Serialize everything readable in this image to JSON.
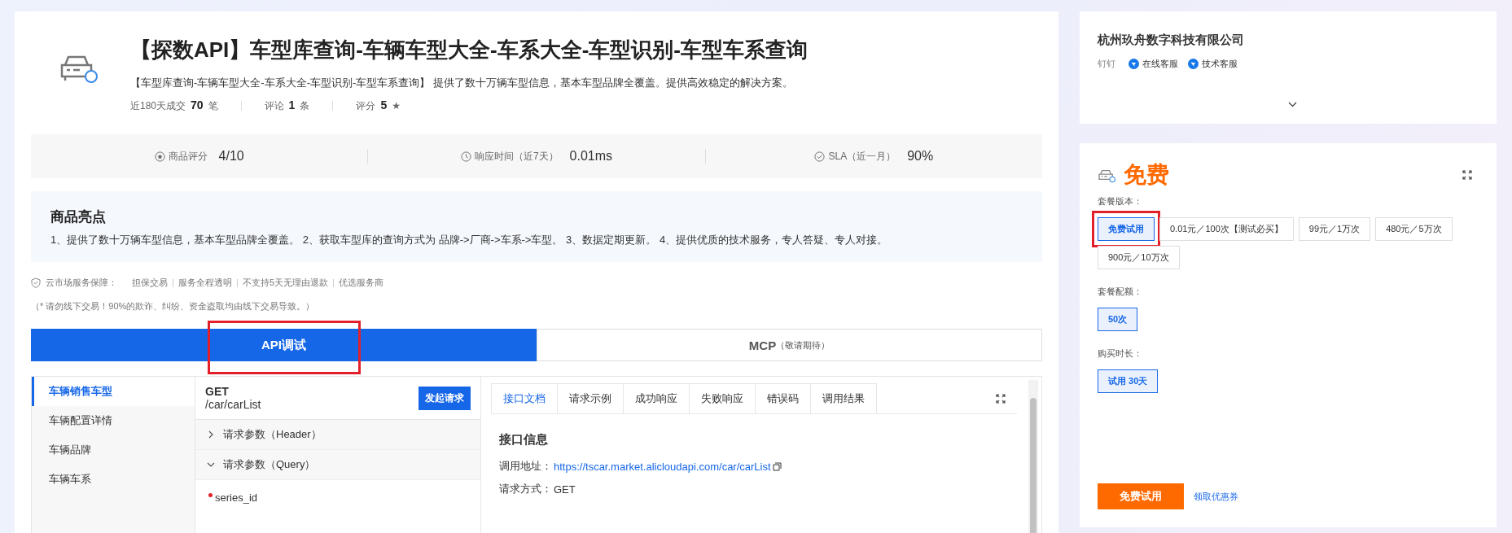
{
  "product": {
    "title": "【探数API】车型库查询-车辆车型大全-车系大全-车型识别-车型车系查询",
    "description": "【车型库查询-车辆车型大全-车系大全-车型识别-车型车系查询】 提供了数十万辆车型信息，基本车型品牌全覆盖。提供高效稳定的解决方案。",
    "stats": [
      {
        "label": "近180天成交",
        "value": "70",
        "unit": "笔"
      },
      {
        "label": "评论",
        "value": "1",
        "unit": "条"
      },
      {
        "label": "评分",
        "value": "5",
        "unit": "★"
      }
    ]
  },
  "metrics": [
    {
      "kind": "star",
      "label": "商品评分",
      "value": "4/10"
    },
    {
      "kind": "clock",
      "label": "响应时间（近7天）",
      "value": "0.01ms"
    },
    {
      "kind": "check",
      "label": "SLA（近一月）",
      "value": "90%"
    }
  ],
  "highlights": {
    "title": "商品亮点",
    "text": "1、提供了数十万辆车型信息，基本车型品牌全覆盖。 2、获取车型库的查询方式为 品牌->厂商->车系->车型。 3、数据定期更新。 4、提供优质的技术服务，专人答疑、专人对接。"
  },
  "guarantee": {
    "label": "云市场服务保障：",
    "items": [
      "担保交易",
      "服务全程透明",
      "不支持5天无理由退款",
      "优选服务商"
    ]
  },
  "notice": "（* 请勿线下交易！90%的欺诈、纠纷、资金盗取均由线下交易导致。）",
  "api_tabs": [
    {
      "label": "API调试",
      "selected": true,
      "highlighted": true
    },
    {
      "label": "MCP",
      "note": "（敬请期待）",
      "selected": false,
      "highlighted": false
    }
  ],
  "api_list": [
    {
      "label": "车辆销售车型",
      "selected": true
    },
    {
      "label": "车辆配置详情",
      "selected": false
    },
    {
      "label": "车辆品牌",
      "selected": false
    },
    {
      "label": "车辆车系",
      "selected": false
    }
  ],
  "endpoint": {
    "method": "GET",
    "path": "/car/carList",
    "send_button": "发起请求",
    "sections": [
      {
        "label": "请求参数（Header）",
        "expanded": false
      },
      {
        "label": "请求参数（Query）",
        "expanded": true
      }
    ],
    "params": [
      {
        "name": "series_id",
        "required": true
      }
    ]
  },
  "doc_tabs": [
    {
      "label": "接口文档",
      "selected": true
    },
    {
      "label": "请求示例",
      "selected": false
    },
    {
      "label": "成功响应",
      "selected": false
    },
    {
      "label": "失败响应",
      "selected": false
    },
    {
      "label": "错误码",
      "selected": false
    },
    {
      "label": "调用结果",
      "selected": false
    }
  ],
  "doc": {
    "heading": "接口信息",
    "fields": [
      {
        "kind": "link",
        "label": "调用地址：",
        "value": "https://tscar.market.alicloudapi.com/car/carList"
      },
      {
        "kind": "text",
        "label": "请求方式：",
        "value": "GET"
      }
    ]
  },
  "vendor": {
    "name": "杭州玖舟数字科技有限公司",
    "contact_label": "钉钉",
    "contacts": [
      "在线客服",
      "技术客服"
    ]
  },
  "pricing": {
    "price": "免费",
    "groups": [
      {
        "label": "套餐版本：",
        "options": [
          {
            "label": "免费试用",
            "selected": true,
            "highlighted": true
          },
          {
            "label": "0.01元／100次【测试必买】",
            "selected": false,
            "highlighted": false
          },
          {
            "label": "99元／1万次",
            "selected": false,
            "highlighted": false
          },
          {
            "label": "480元／5万次",
            "selected": false,
            "highlighted": false
          },
          {
            "label": "900元／10万次",
            "selected": false,
            "highlighted": false
          }
        ]
      },
      {
        "label": "套餐配额：",
        "options": [
          {
            "label": "50次",
            "selected": true,
            "highlighted": false
          }
        ]
      },
      {
        "label": "购买时长：",
        "options": [
          {
            "label": "试用 30天",
            "selected": true,
            "highlighted": false
          }
        ]
      }
    ],
    "buy_button": "免费试用",
    "coupon_link": "领取优惠券"
  }
}
